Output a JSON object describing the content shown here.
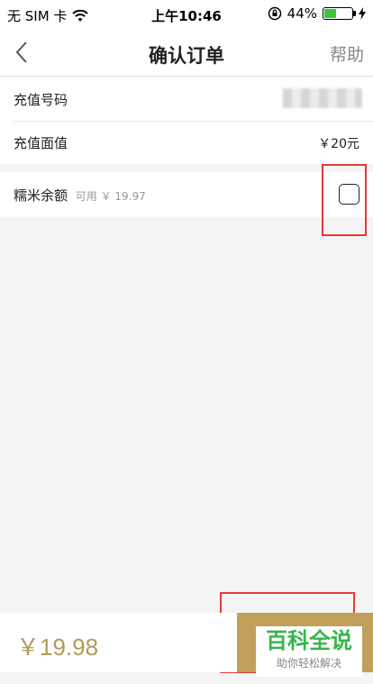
{
  "status_bar": {
    "carrier": "无 SIM 卡",
    "time": "上午10:46",
    "battery": "44%",
    "battery_level": 0.44
  },
  "navbar": {
    "title": "确认订单",
    "help": "帮助"
  },
  "recharge_number": {
    "label": "充值号码"
  },
  "recharge_amount": {
    "label": "充值面值",
    "value": "￥20元"
  },
  "balance": {
    "label": "糯米余额",
    "available": "可用 ￥ 19.97"
  },
  "footer": {
    "total": "￥19.98"
  },
  "watermark": {
    "line1": "百科全说",
    "line2": "助你轻松解决"
  },
  "colors": {
    "accent": "#c0a05a",
    "price": "#b49a5a",
    "highlight": "#e53a3a"
  }
}
